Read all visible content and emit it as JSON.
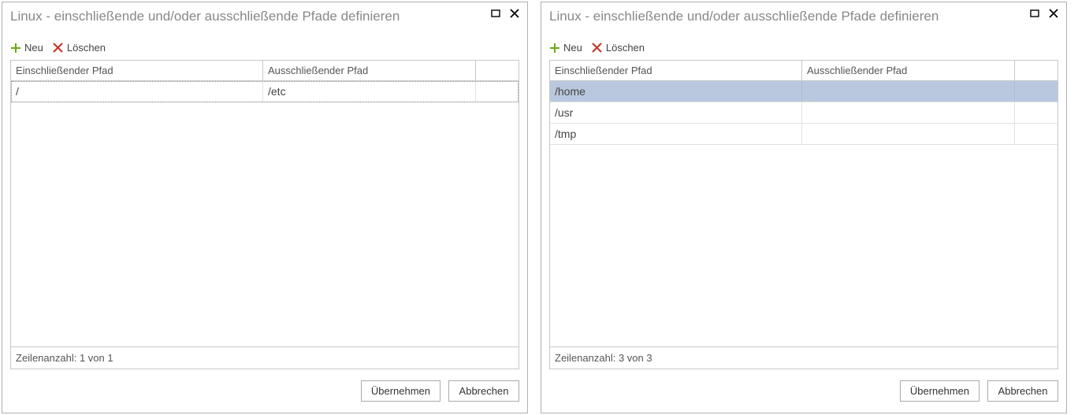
{
  "dialogs": [
    {
      "title": "Linux - einschließende und/oder ausschließende Pfade definieren",
      "toolbar": {
        "new_label": "Neu",
        "delete_label": "Löschen"
      },
      "columns": {
        "include": "Einschließender Pfad",
        "exclude": "Ausschließender Pfad"
      },
      "rows": [
        {
          "include": "/",
          "exclude": "/etc",
          "selected": false,
          "focused": true
        }
      ],
      "row_count_label": "Zeilenanzahl: 1 von 1",
      "buttons": {
        "apply": "Übernehmen",
        "cancel": "Abbrechen"
      }
    },
    {
      "title": "Linux - einschließende und/oder ausschließende Pfade definieren",
      "toolbar": {
        "new_label": "Neu",
        "delete_label": "Löschen"
      },
      "columns": {
        "include": "Einschließender Pfad",
        "exclude": "Ausschließender Pfad"
      },
      "rows": [
        {
          "include": "/home",
          "exclude": "",
          "selected": true,
          "focused": false
        },
        {
          "include": "/usr",
          "exclude": "",
          "selected": false,
          "focused": false
        },
        {
          "include": "/tmp",
          "exclude": "",
          "selected": false,
          "focused": false
        }
      ],
      "row_count_label": "Zeilenanzahl: 3 von 3",
      "buttons": {
        "apply": "Übernehmen",
        "cancel": "Abbrechen"
      }
    }
  ]
}
